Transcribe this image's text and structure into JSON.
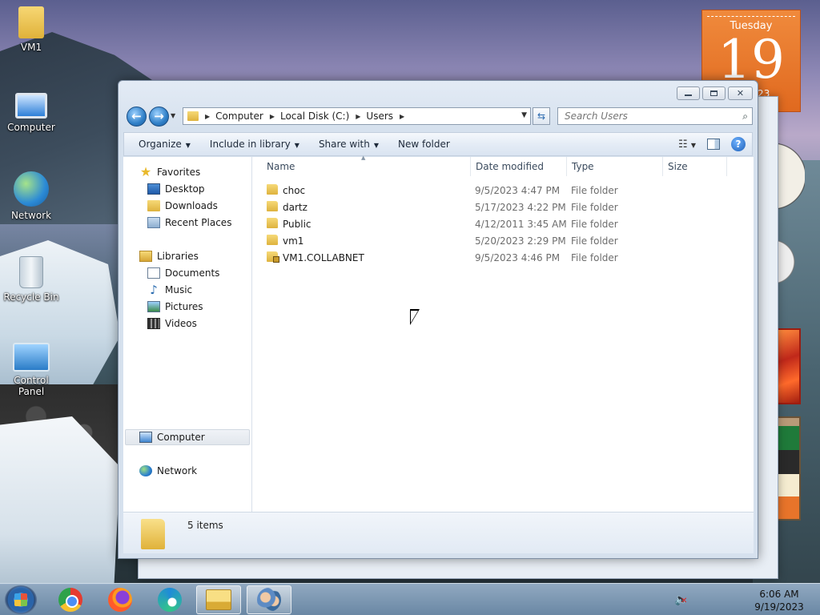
{
  "desktop": {
    "icons": [
      {
        "label": "VM1"
      },
      {
        "label": "Computer"
      },
      {
        "label": "Network"
      },
      {
        "label": "Recycle Bin"
      },
      {
        "label": "Control Panel"
      }
    ],
    "calendar_gadget": {
      "day_name": "Tuesday",
      "day_number": "19",
      "month_year": "er 2023"
    }
  },
  "window": {
    "address_bar": {
      "crumbs": [
        "Computer",
        "Local Disk (C:)",
        "Users"
      ]
    },
    "search": {
      "placeholder": "Search Users"
    },
    "command_bar": {
      "organize": "Organize",
      "include_in_library": "Include in library",
      "share_with": "Share with",
      "new_folder": "New folder"
    },
    "nav_pane": {
      "favorites": "Favorites",
      "favorites_items": [
        "Desktop",
        "Downloads",
        "Recent Places"
      ],
      "libraries": "Libraries",
      "libraries_items": [
        "Documents",
        "Music",
        "Pictures",
        "Videos"
      ],
      "computer": "Computer",
      "network": "Network"
    },
    "columns": {
      "name": "Name",
      "date_modified": "Date modified",
      "type": "Type",
      "size": "Size"
    },
    "files": [
      {
        "name": "choc",
        "date": "9/5/2023 4:47 PM",
        "type": "File folder",
        "locked": false
      },
      {
        "name": "dartz",
        "date": "5/17/2023 4:22 PM",
        "type": "File folder",
        "locked": false
      },
      {
        "name": "Public",
        "date": "4/12/2011 3:45 AM",
        "type": "File folder",
        "locked": false
      },
      {
        "name": "vm1",
        "date": "5/20/2023 2:29 PM",
        "type": "File folder",
        "locked": false
      },
      {
        "name": "VM1.COLLABNET",
        "date": "9/5/2023 4:46 PM",
        "type": "File folder",
        "locked": true
      }
    ],
    "details": {
      "item_count": "5 items"
    }
  },
  "taskbar": {
    "apps": [
      "chrome",
      "firefox",
      "edge",
      "windows-explorer",
      "users-app"
    ],
    "clock": {
      "time": "6:06 AM",
      "date": "9/19/2023"
    }
  }
}
